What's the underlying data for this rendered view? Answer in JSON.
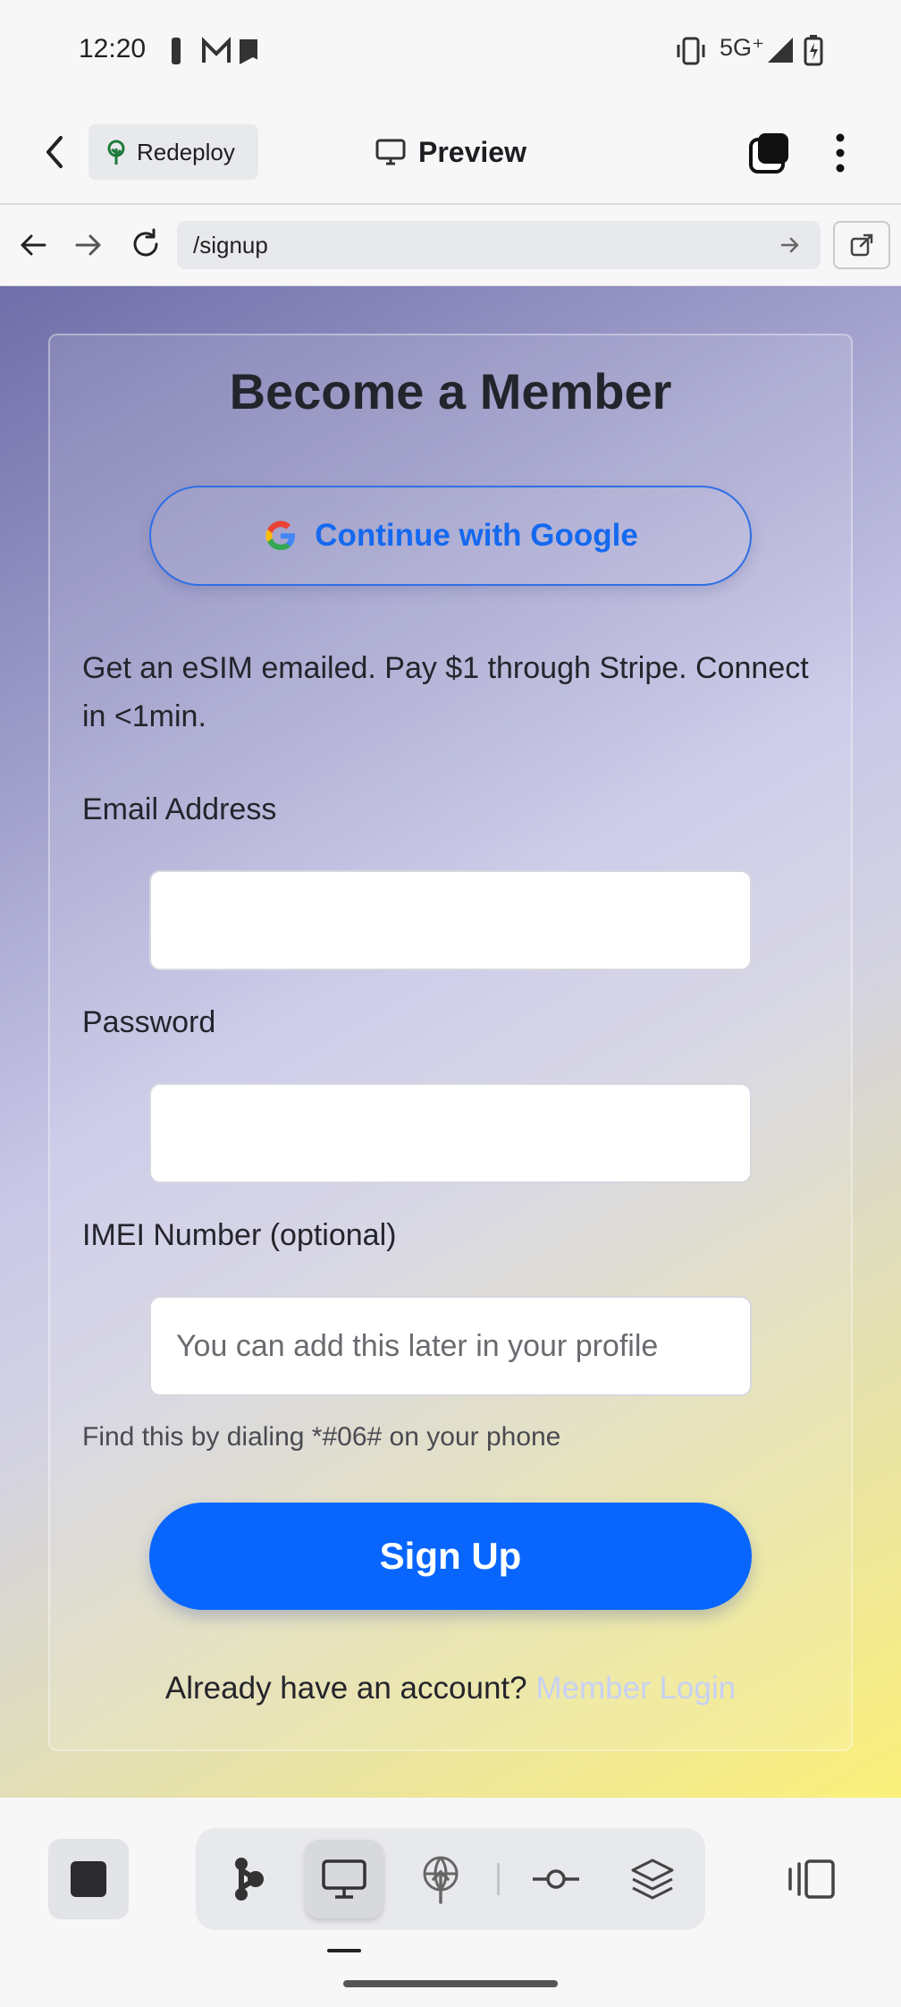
{
  "status_bar": {
    "time": "12:20",
    "network": "5G⁺"
  },
  "app_header": {
    "redeploy_label": "Redeploy",
    "preview_label": "Preview"
  },
  "browser": {
    "url": "/signup"
  },
  "signup_form": {
    "title": "Become a Member",
    "google_button": "Continue with Google",
    "description": "Get an eSIM emailed. Pay $1 through Stripe. Connect in <1min.",
    "email_label": "Email Address",
    "email_value": "",
    "password_label": "Password",
    "password_value": "",
    "imei_label": "IMEI Number (optional)",
    "imei_placeholder": "You can add this later in your profile",
    "imei_hint": "Find this by dialing *#06# on your phone",
    "submit_label": "Sign Up",
    "login_prompt": "Already have an account?",
    "login_link": "Member Login"
  },
  "colors": {
    "accent": "#0866ff",
    "google_text": "#1469f0",
    "link_faded": "#c7d1f5"
  },
  "icons": [
    "back-icon",
    "tree-icon",
    "monitor-icon",
    "tabs-icon",
    "more-icon",
    "arrow-left-icon",
    "arrow-right-icon",
    "reload-icon",
    "open-external-icon",
    "google-icon",
    "stop-icon",
    "agent-icon",
    "desktop-icon",
    "deploy-icon",
    "commit-icon",
    "layers-icon",
    "split-view-icon"
  ]
}
